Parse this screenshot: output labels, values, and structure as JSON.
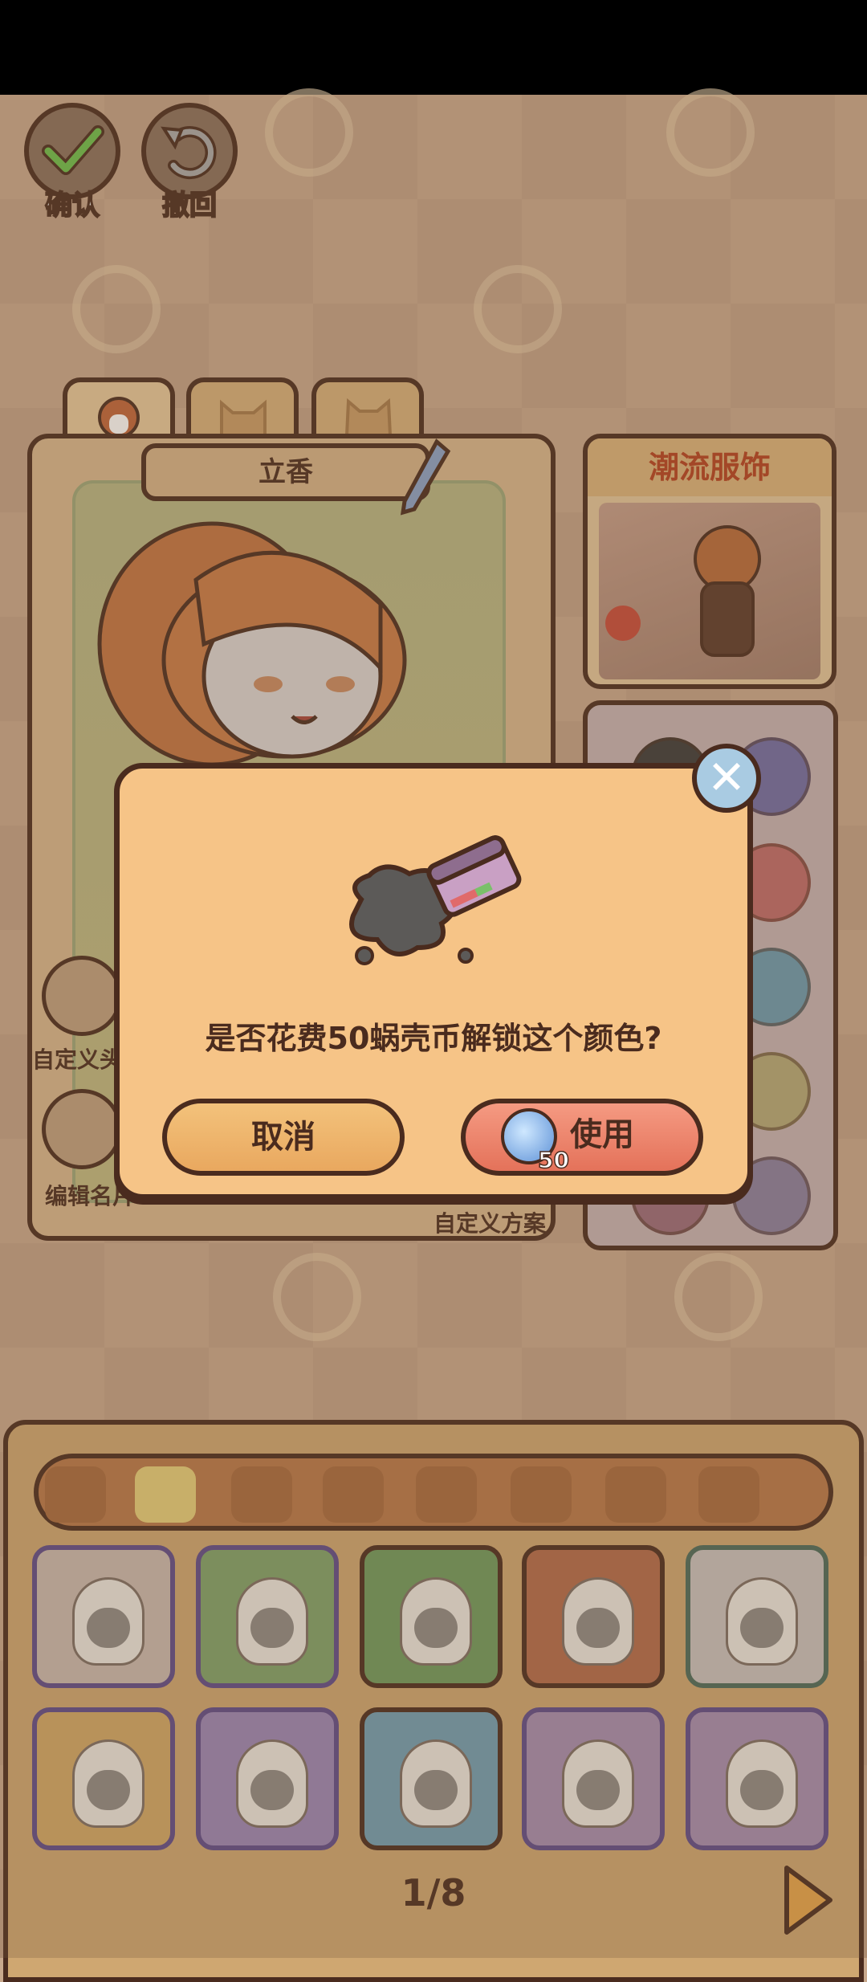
{
  "toolbar": {
    "confirm_label": "确认",
    "undo_label": "撤回"
  },
  "character": {
    "name": "立香",
    "customize_label": "自定义头",
    "edit_name_label": "编辑名片",
    "custom_plan_label": "自定义方案"
  },
  "fashion": {
    "title": "潮流服饰"
  },
  "dialog": {
    "message": "是否花费50蜗壳币解锁这个颜色?",
    "cancel_label": "取消",
    "use_label": "使用",
    "cost": "50"
  },
  "pagination": {
    "page": "1/8"
  },
  "colors": {
    "accent": "#4a2b1e",
    "dialog_bg": "#f6c487",
    "cancel_btn": "#e9a85f",
    "use_btn": "#e4725a"
  }
}
